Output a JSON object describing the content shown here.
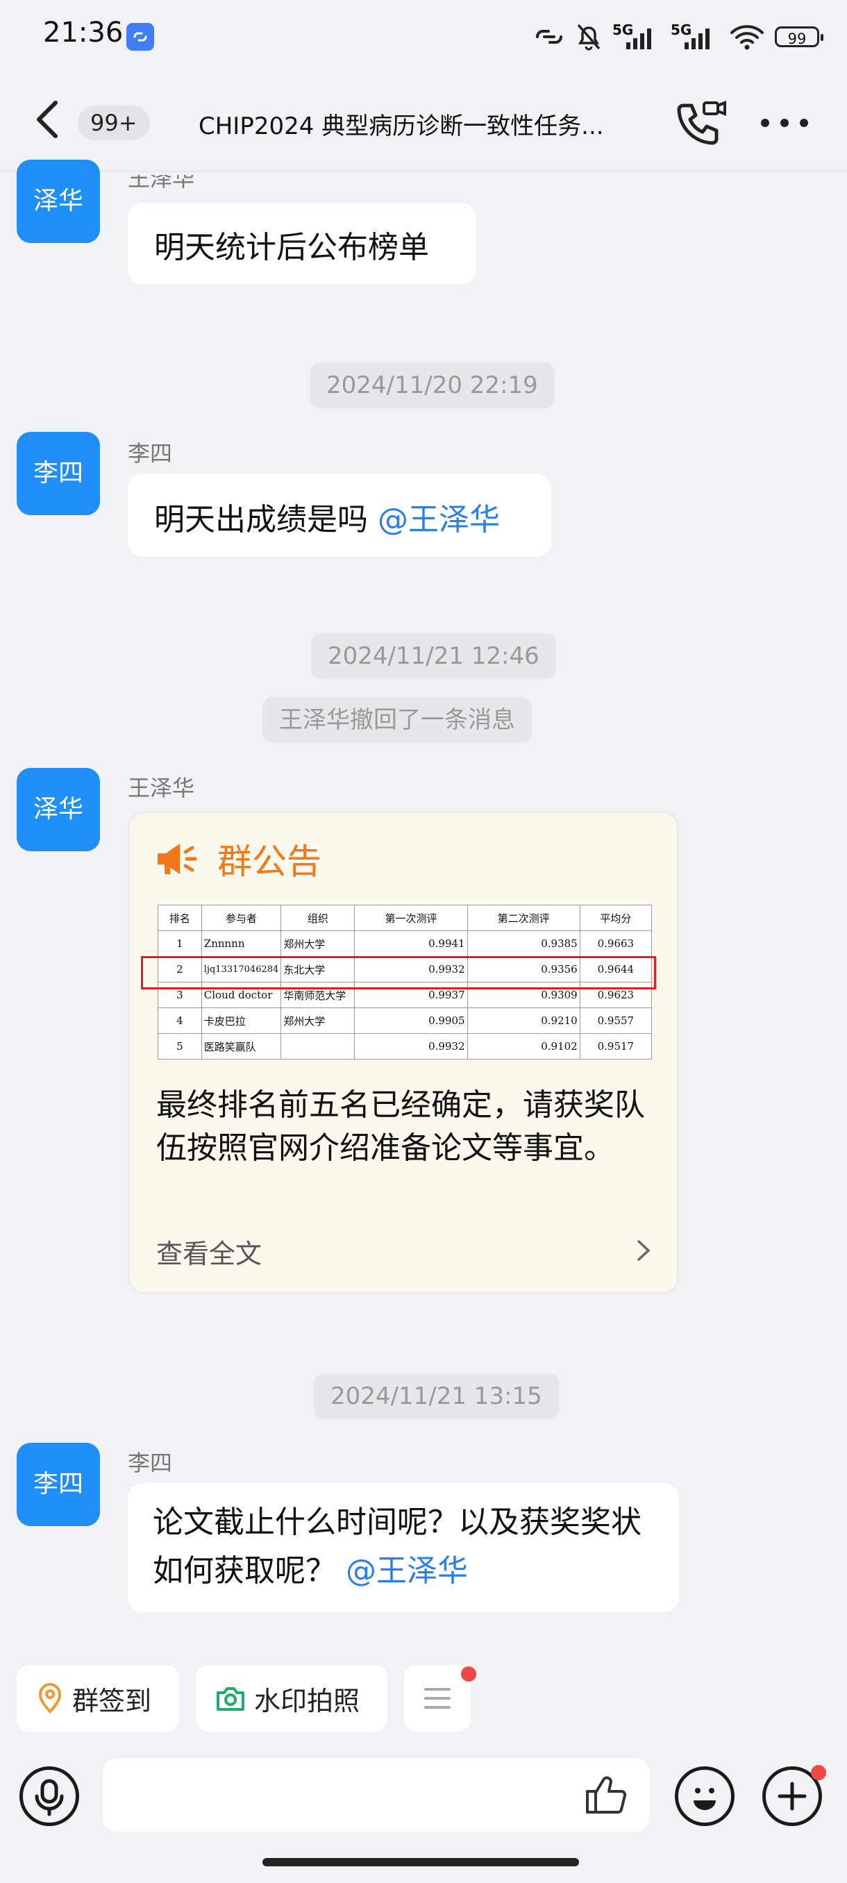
{
  "status_bar": {
    "time": "21:36",
    "battery": "99",
    "network_1": "5G",
    "network_2": "5G"
  },
  "header": {
    "unread_count": "99+",
    "title": "CHIP2024 典型病历诊断一致性任务..."
  },
  "messages": [
    {
      "sender": "王泽华",
      "avatar_text": "泽华",
      "text": "明天统计后公布榜单"
    },
    {
      "timestamp": "2024/11/20 22:19"
    },
    {
      "sender": "李四",
      "avatar_text": "李四",
      "text": "明天出成绩是吗 ",
      "mention": "@王泽华"
    },
    {
      "timestamp": "2024/11/21 12:46"
    },
    {
      "system": "王泽华撤回了一条消息"
    },
    {
      "sender": "王泽华",
      "avatar_text": "泽华"
    },
    {
      "timestamp": "2024/11/21 13:15"
    },
    {
      "sender": "李四",
      "avatar_text": "李四",
      "text": "论文截止什么时间呢？以及获奖奖状如何获取呢？ ",
      "mention": "@王泽华"
    }
  ],
  "announcement": {
    "title": "群公告",
    "table": {
      "headers": [
        "排名",
        "参与者",
        "组织",
        "第一次测评",
        "第二次测评",
        "平均分"
      ],
      "rows": [
        [
          "1",
          "Znnnnn",
          "郑州大学",
          "0.9941",
          "0.9385",
          "0.9663"
        ],
        [
          "2",
          "ljq13317046284",
          "东北大学",
          "0.9932",
          "0.9356",
          "0.9644"
        ],
        [
          "3",
          "Cloud doctor",
          "华南师范大学",
          "0.9937",
          "0.9309",
          "0.9623"
        ],
        [
          "4",
          "卡皮巴拉",
          "郑州大学",
          "0.9905",
          "0.9210",
          "0.9557"
        ],
        [
          "5",
          "医路笑赢队",
          "",
          "0.9932",
          "0.9102",
          "0.9517"
        ]
      ]
    },
    "body": "最终排名前五名已经确定，请获奖队伍按照官网介绍准备论文等事宜。",
    "read_more": "查看全文"
  },
  "quick_actions": [
    {
      "label": "群签到",
      "icon": "location-pin-icon"
    },
    {
      "label": "水印拍照",
      "icon": "camera-icon"
    },
    {
      "label": "",
      "icon": "menu-icon"
    }
  ],
  "colors": {
    "avatar": "#1f8ef7",
    "mention": "#2a7ee8",
    "announcement_accent": "#f07a19",
    "highlight": "#e02020"
  }
}
